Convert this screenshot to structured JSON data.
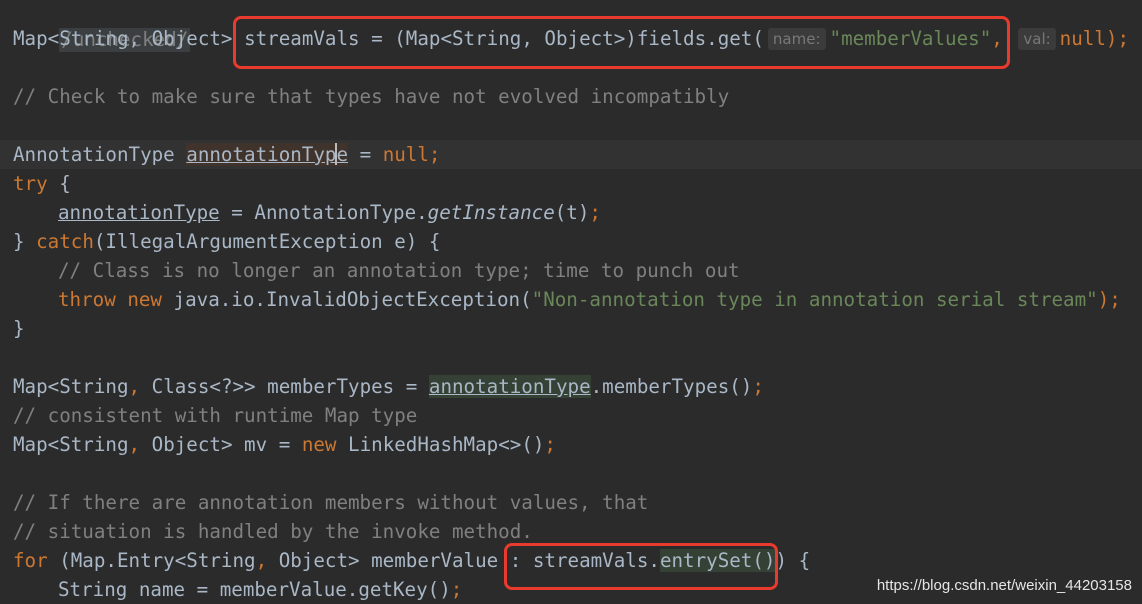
{
  "annotation_tag": "/unchecked/",
  "line_streamvals": {
    "type": "Map<String, Object>",
    "var": "streamVals",
    "assign": " = (Map<String, Object>)fields.get(",
    "hint_name": "name:",
    "arg_name": "\"memberValues\"",
    "comma": ",",
    "hint_val": "val:",
    "arg_val": "null",
    "end": ");"
  },
  "comment_check": "// Check to make sure that types have not evolved incompatibly",
  "line_annotation_decl": {
    "type": "AnnotationType ",
    "var_a": "annotationTyp",
    "var_b": "e",
    "assign": " = ",
    "null": "null",
    "semi": ";"
  },
  "line_try": {
    "kw": "try",
    "rest": " {"
  },
  "line_get_instance": {
    "var": "annotationType",
    "assign": " = AnnotationType.",
    "method": "getInstance",
    "args": "(t)",
    "semi": ";"
  },
  "line_catch": {
    "open": "} ",
    "kw": "catch",
    "rest": "(IllegalArgumentException e) {"
  },
  "comment_class": "// Class is no longer an annotation type; time to punch out",
  "line_throw": {
    "kw_throw": "throw",
    "kw_new": "new",
    "cls": " java.io.InvalidObjectException(",
    "msg": "\"Non-annotation type in annotation serial stream\"",
    "end": ");"
  },
  "line_close": "}",
  "line_member_types": {
    "type": "Map<String",
    "comma": ",",
    "type2": " Class<?>> memberTypes = ",
    "var": "annotationType",
    "call": ".memberTypes()",
    "semi": ";"
  },
  "comment_consistent": "// consistent with runtime Map type",
  "line_mv": {
    "type": "Map<String",
    "comma": ",",
    "type2": " Object> mv = ",
    "kw_new": "new",
    "cls": " LinkedHashMap<>()",
    "semi": ";"
  },
  "comment_if_there": "// If there are annotation members without values, that",
  "comment_situation": "// situation is handled by the invoke method.",
  "line_for": {
    "kw": "for",
    "head": " (Map.Entry<String",
    "comma": ",",
    "head2": " Object> memberValue : ",
    "var": "streamVals.",
    "method": "entrySet()",
    "end": ") {"
  },
  "line_string_name": {
    "text": "String name = memberValue.getKey()",
    "semi": ";"
  },
  "watermark": "https://blog.csdn.net/weixin_44203158",
  "colors": {
    "background": "#2b2b2b",
    "keyword": "#cc7832",
    "string": "#6a8759",
    "comment": "#808080",
    "highlight_box": "#e83b2e"
  }
}
